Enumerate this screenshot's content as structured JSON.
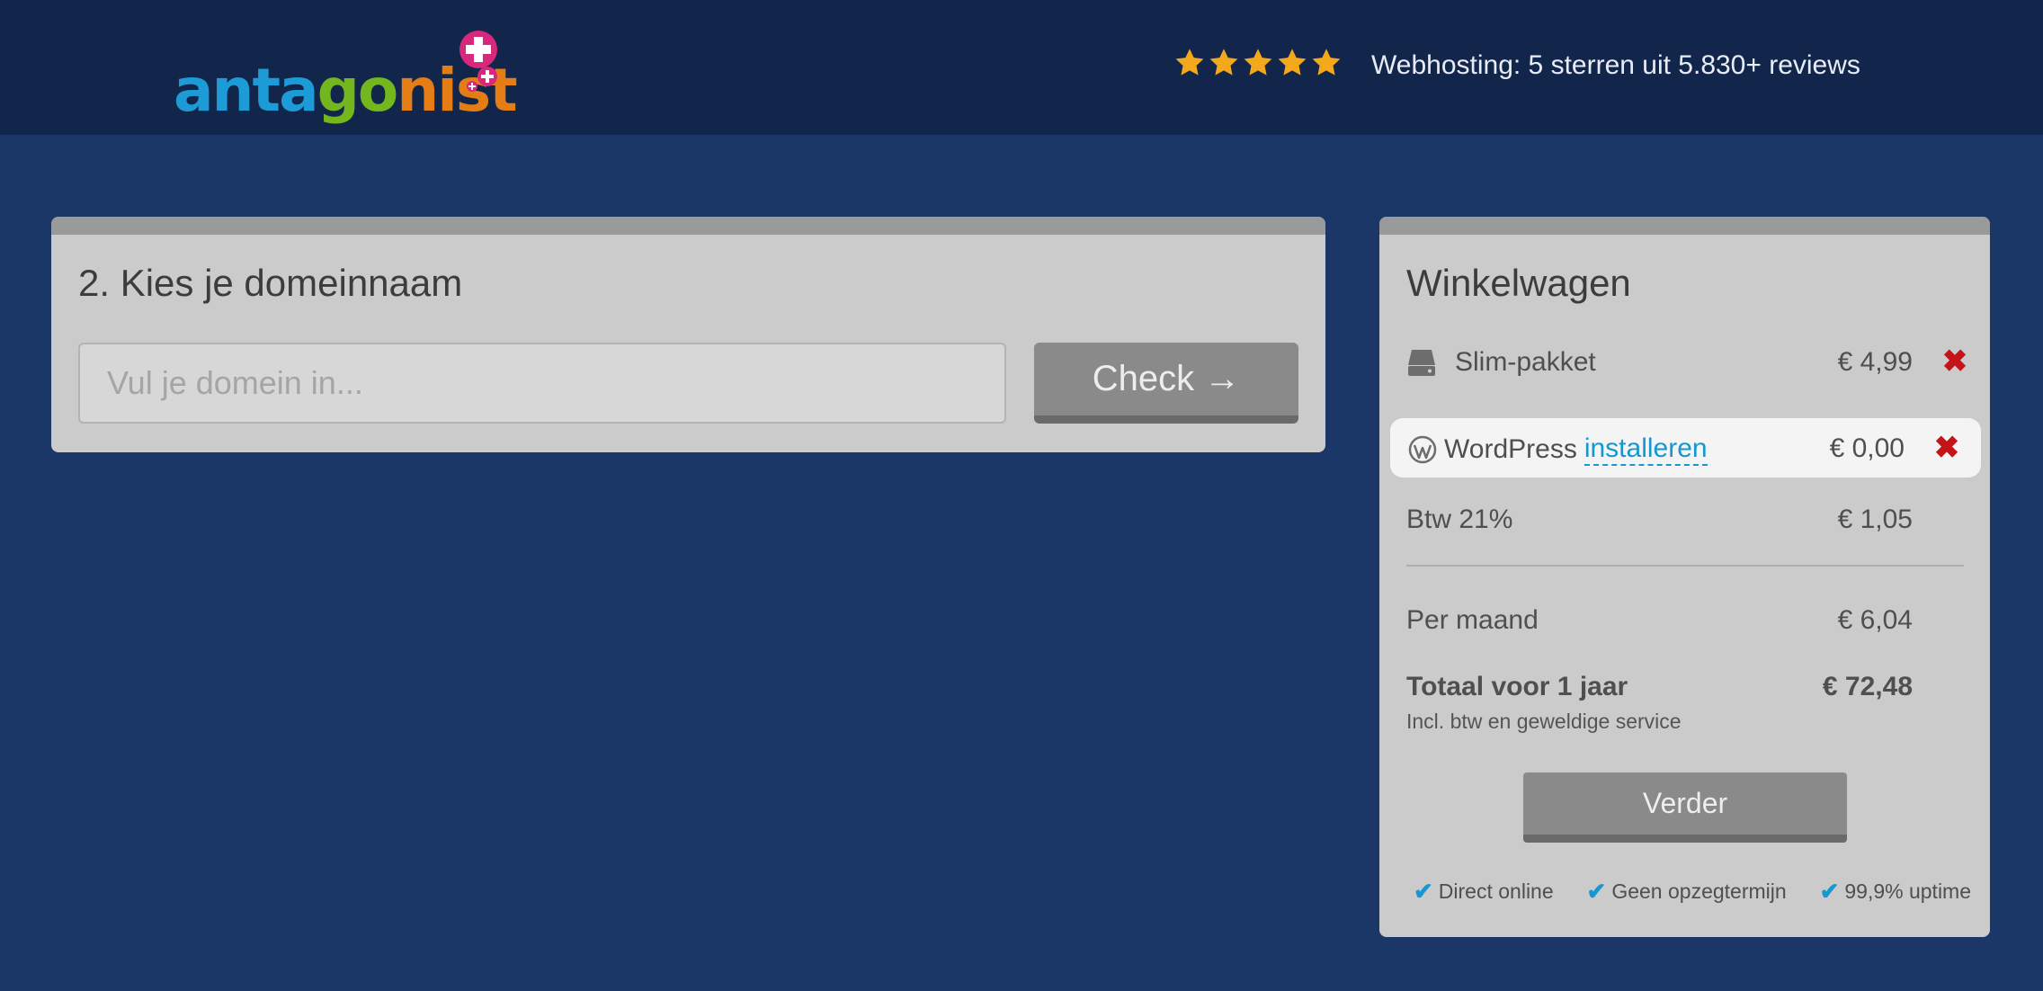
{
  "header": {
    "logo_text": "antagonist",
    "logo_letters": [
      {
        "ch": "a",
        "color": "#1c9bd7"
      },
      {
        "ch": "n",
        "color": "#1c9bd7"
      },
      {
        "ch": "t",
        "color": "#1c9bd7"
      },
      {
        "ch": "a",
        "color": "#1c9bd7"
      },
      {
        "ch": "g",
        "color": "#73b61e"
      },
      {
        "ch": "o",
        "color": "#73b61e"
      },
      {
        "ch": "n",
        "color": "#e47d16"
      },
      {
        "ch": "i",
        "color": "#e47d16"
      },
      {
        "ch": "s",
        "color": "#e47d16"
      },
      {
        "ch": "t",
        "color": "#e47d16"
      }
    ],
    "rating_stars": 5,
    "star_color": "#f3a91b",
    "reviews_text": "Webhosting: 5 sterren uit 5.830+ reviews"
  },
  "domain": {
    "title": "2. Kies je domeinnaam",
    "input_placeholder": "Vul je domein in...",
    "input_value": "",
    "check_label": "Check →"
  },
  "cart": {
    "title": "Winkelwagen",
    "items": [
      {
        "icon": "server-icon",
        "label": "Slim-pakket",
        "price": "€ 4,99"
      },
      {
        "icon": "wordpress-icon",
        "label": "WordPress",
        "link": "installeren",
        "price": "€ 0,00"
      }
    ],
    "vat_label": "Btw 21%",
    "vat_value": "€ 1,05",
    "monthly_label": "Per maand",
    "monthly_value": "€ 6,04",
    "total_label": "Totaal voor 1 jaar",
    "total_value": "€ 72,48",
    "note": "Incl. btw en geweldige service",
    "continue_label": "Verder",
    "features": [
      "Direct online",
      "Geen opzegtermijn",
      "99,9% uptime"
    ],
    "remove_color": "#c4141a",
    "link_color": "#1598d1"
  }
}
